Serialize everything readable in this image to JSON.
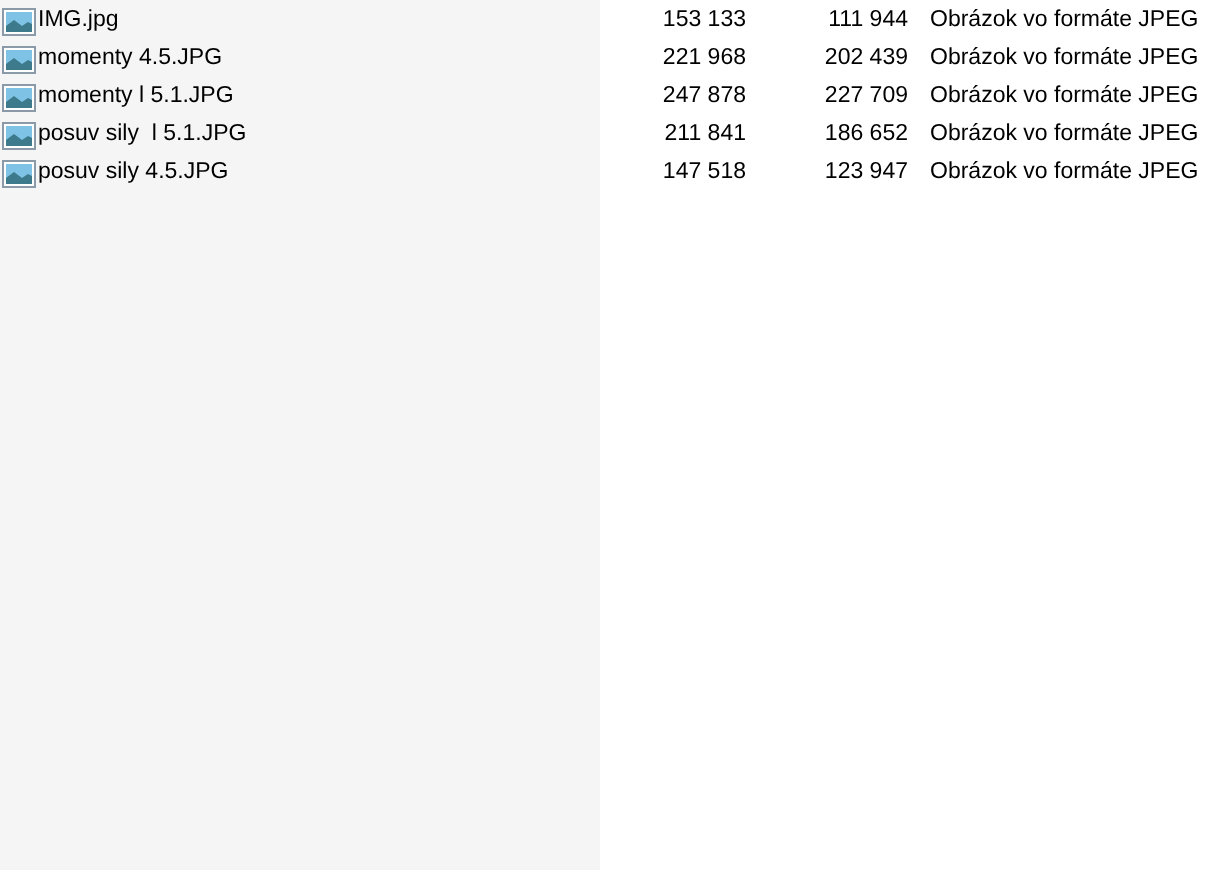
{
  "files": [
    {
      "name": "IMG.jpg",
      "size": "153 133",
      "compressed_size": "111 944",
      "type": "Obrázok vo formáte JPEG"
    },
    {
      "name": "momenty 4.5.JPG",
      "size": "221 968",
      "compressed_size": "202 439",
      "type": "Obrázok vo formáte JPEG"
    },
    {
      "name": "momenty l 5.1.JPG",
      "size": "247 878",
      "compressed_size": "227 709",
      "type": "Obrázok vo formáte JPEG"
    },
    {
      "name": "posuv sily  l 5.1.JPG",
      "size": "211 841",
      "compressed_size": "186 652",
      "type": "Obrázok vo formáte JPEG"
    },
    {
      "name": "posuv sily 4.5.JPG",
      "size": "147 518",
      "compressed_size": "123 947",
      "type": "Obrázok vo formáte JPEG"
    }
  ]
}
